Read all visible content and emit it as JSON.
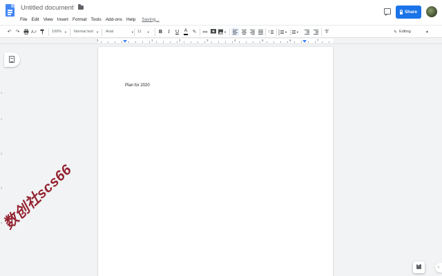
{
  "header": {
    "title": "Untitled document",
    "menus": [
      "File",
      "Edit",
      "View",
      "Insert",
      "Format",
      "Tools",
      "Add-ons",
      "Help"
    ],
    "status": "Saving...",
    "share_label": "Share",
    "icons": {
      "app": "google-docs-icon",
      "star": "star-outline-icon",
      "folder": "folder-icon",
      "comment": "comment-history-icon",
      "lock": "lock-icon"
    }
  },
  "toolbar": {
    "zoom": "100%",
    "style": "Normal text",
    "font": "Arial",
    "font_size": "11",
    "bold": "B",
    "italic": "I",
    "underline": "U",
    "text_color": "A",
    "mode": "Editing",
    "active_alignment": "left"
  },
  "ruler": {
    "numbers": [
      "1",
      "1",
      "2",
      "3",
      "4",
      "5",
      "6",
      "7"
    ]
  },
  "vertical_ruler": {
    "numbers": [
      "1",
      "1",
      "2",
      "3",
      "4"
    ]
  },
  "document": {
    "text": "Plan for 2020"
  },
  "watermark": {
    "text": "数创社scs66"
  },
  "colors": {
    "accent": "#1a73e8",
    "app_icon": "#4285f4",
    "background": "#f1f3f4",
    "watermark": "#8b0d1c"
  }
}
